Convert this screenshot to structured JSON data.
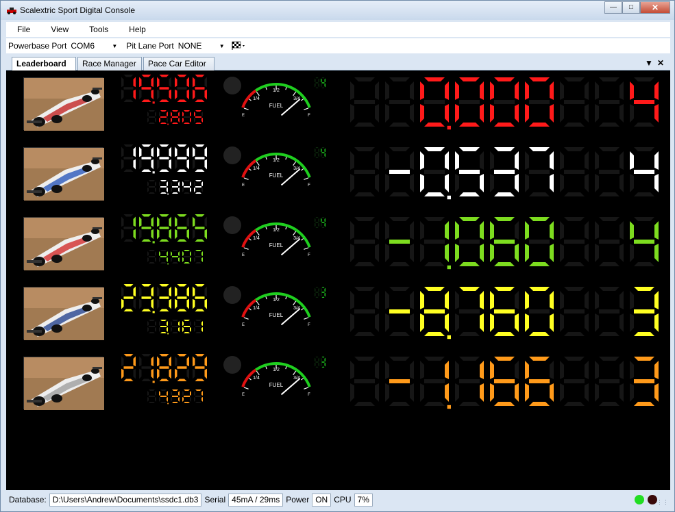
{
  "window": {
    "title": "Scalextric Sport Digital Console"
  },
  "menu": [
    "File",
    "View",
    "Tools",
    "Help"
  ],
  "toolbar": {
    "powerbase_label": "Powerbase Port",
    "powerbase_value": "COM6",
    "pitlane_label": "Pit Lane Port",
    "pitlane_value": "NONE"
  },
  "tabs": [
    "Leaderboard",
    "Race Manager",
    "Pace Car Editor"
  ],
  "gauge_labels": {
    "quarter": "1/4",
    "half": "1/2",
    "three_quarter": "3/4",
    "fuel": "FUEL",
    "empty": "E",
    "full": "F"
  },
  "rows": [
    {
      "color": "#ff1a1a",
      "lap_time": "19.506",
      "best_time": "2.805",
      "laps": "4",
      "gap": "0.000",
      "position": "4",
      "fuel": 0.85
    },
    {
      "color": "#ffffff",
      "lap_time": "19.999",
      "best_time": "3.342",
      "laps": "4",
      "gap": "-0.537",
      "position": "4",
      "fuel": 0.85
    },
    {
      "color": "#7ddc1f",
      "lap_time": "19.865",
      "best_time": "4.407",
      "laps": "4",
      "gap": "-1.060",
      "position": "4",
      "fuel": 0.85
    },
    {
      "color": "#ffff22",
      "lap_time": "23.386",
      "best_time": "3.161",
      "laps": "3",
      "gap": "-8.760",
      "position": "3",
      "fuel": 0.85
    },
    {
      "color": "#ff9a1a",
      "lap_time": "21.829",
      "best_time": "4.327",
      "laps": "3",
      "gap": "-1.166",
      "position": "3",
      "fuel": 0.85
    }
  ],
  "status": {
    "database_label": "Database:",
    "database_value": "D:\\Users\\Andrew\\Documents\\ssdc1.db3",
    "serial_label": "Serial",
    "serial_value": "45mA / 29ms",
    "power_label": "Power",
    "power_value": "ON",
    "cpu_label": "CPU",
    "cpu_value": "7%",
    "indicator_1_color": "#22dd22",
    "indicator_2_color": "#3a0a0a"
  },
  "icons": [
    "app-car-icon",
    "minimize-icon",
    "maximize-icon",
    "close-icon",
    "chequered-flag-icon",
    "chevron-down-icon",
    "tab-close-icon",
    "car-photo"
  ]
}
